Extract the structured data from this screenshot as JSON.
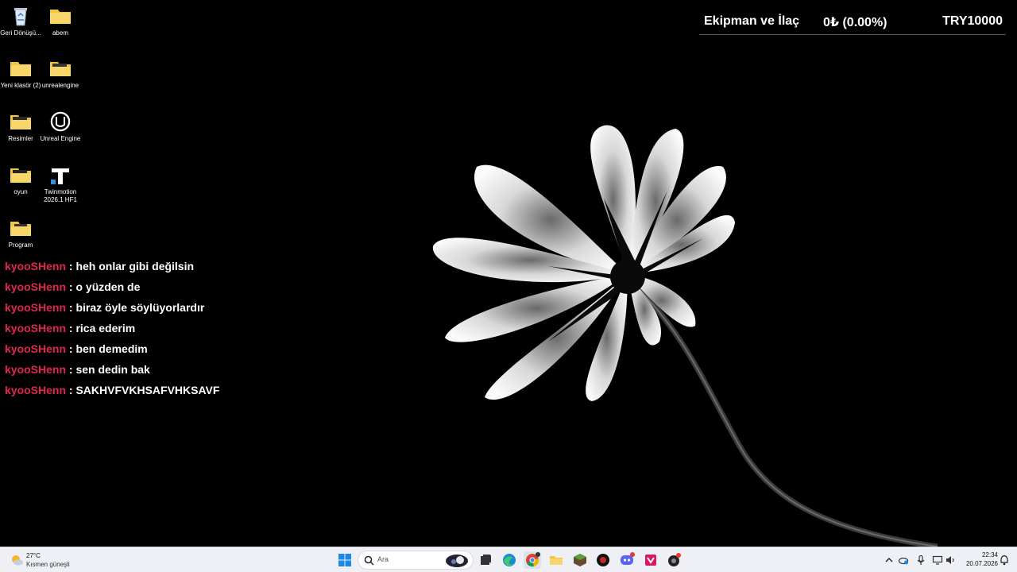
{
  "desktop": {
    "icons": [
      {
        "label": "Geri Dönüşü...",
        "icon": "recycle-bin-icon"
      },
      {
        "label": "abem",
        "icon": "folder-icon"
      },
      {
        "label": "Yeni klasör (2)",
        "icon": "folder-icon"
      },
      {
        "label": "unrealengine",
        "icon": "folder-icon"
      },
      {
        "label": "Resimler",
        "icon": "folder-icon"
      },
      {
        "label": "Unreal Engine",
        "icon": "unreal-engine-icon"
      },
      {
        "label": "oyun",
        "icon": "folder-icon"
      },
      {
        "label": "Twinmotion 2026.1 HF1",
        "icon": "twinmotion-icon"
      },
      {
        "label": "Program",
        "icon": "folder-icon"
      }
    ]
  },
  "overlay": {
    "category": "Ekipman ve İlaç",
    "change": "0₺ (0.00%)",
    "balance": "TRY10000"
  },
  "chat": {
    "separator": ":",
    "messages": [
      {
        "user": "kyooSHenn",
        "text": "heh onlar gibi değilsin"
      },
      {
        "user": "kyooSHenn",
        "text": "o yüzden de"
      },
      {
        "user": "kyooSHenn",
        "text": "biraz öyle söylüyorlardır"
      },
      {
        "user": "kyooSHenn",
        "text": "rica ederim"
      },
      {
        "user": "kyooSHenn",
        "text": "ben demedim"
      },
      {
        "user": "kyooSHenn",
        "text": "sen dedin bak"
      },
      {
        "user": "kyooSHenn",
        "text": "SAKHVFVKHSAFVHKSAVF"
      }
    ]
  },
  "taskbar": {
    "weather": {
      "temp": "27°C",
      "desc": "Kısmen güneşli"
    },
    "search_placeholder": "Ara",
    "pinned": [
      "task-view-icon",
      "edge-icon",
      "chrome-icon",
      "file-explorer-icon",
      "minecraft-icon",
      "app-red-icon",
      "discord-icon",
      "app-pink-icon",
      "app-dark-icon"
    ],
    "clock": {
      "time": "22:34",
      "date": "20.07.2026"
    }
  },
  "colors": {
    "chat_user": "#e0264f",
    "taskbar_bg": "#eef0f6"
  }
}
